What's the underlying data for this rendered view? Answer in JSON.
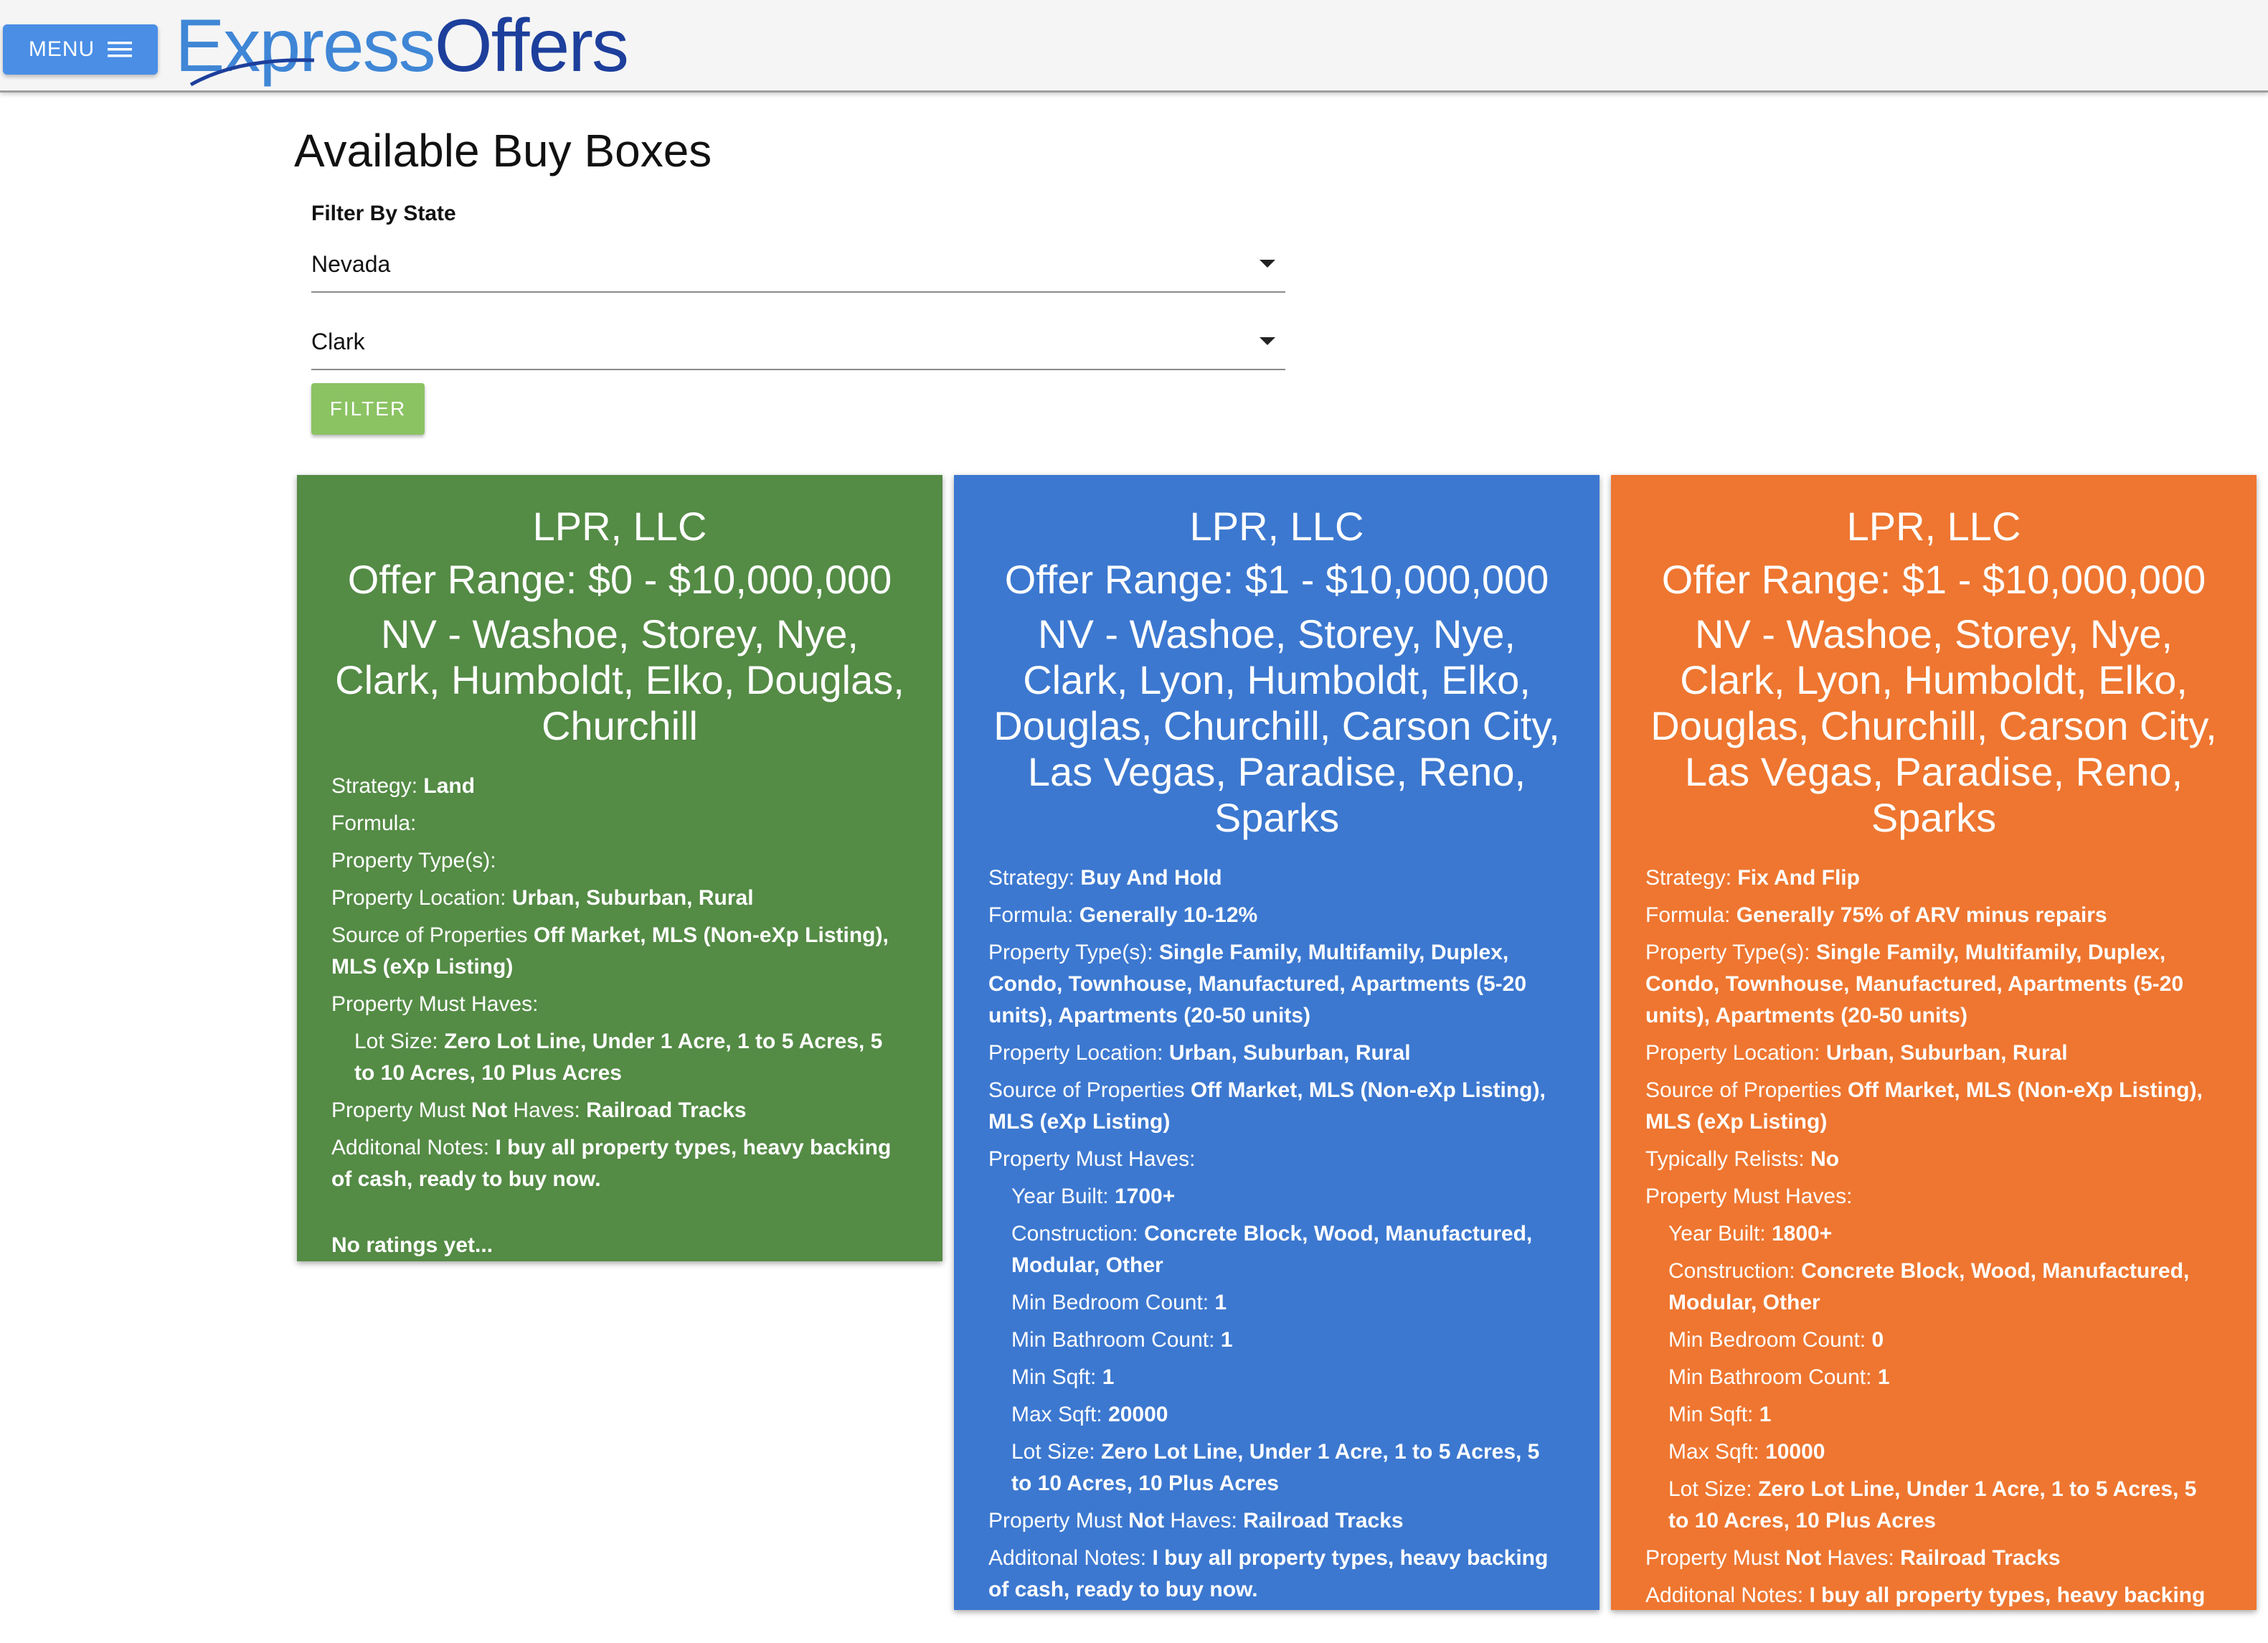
{
  "header": {
    "menu_label": "MENU",
    "logo_part1": "Express",
    "logo_part2": "Offers"
  },
  "page": {
    "title": "Available Buy Boxes",
    "filter_label": "Filter By State",
    "state_value": "Nevada",
    "county_value": "Clark",
    "filter_button": "FILTER"
  },
  "labels": {
    "strategy": "Strategy:",
    "formula": "Formula:",
    "property_types": "Property Type(s):",
    "property_location": "Property Location:",
    "source": "Source of Properties",
    "relists": "Typically Relists:",
    "must_haves": "Property Must Haves:",
    "year_built": "Year Built:",
    "construction": "Construction:",
    "min_bed": "Min Bedroom Count:",
    "min_bath": "Min Bathroom Count:",
    "min_sqft": "Min Sqft:",
    "max_sqft": "Max Sqft:",
    "lot_size": "Lot Size:",
    "not_haves_pre": "Property Must",
    "not_haves_not": "Not",
    "not_haves_post": "Haves:",
    "notes": "Additonal Notes:"
  },
  "cards": [
    {
      "color": "#548b45",
      "name": "LPR, LLC",
      "offer_range": "Offer Range: $0 - $10,000,000",
      "area": "NV - Washoe, Storey, Nye, Clark, Humboldt, Elko, Douglas, Churchill",
      "strategy": "Land",
      "formula": "",
      "property_types": "",
      "property_location": "Urban, Suburban, Rural",
      "source": "Off Market, MLS (Non-eXp Listing), MLS (eXp Listing)",
      "lot_size": "Zero Lot Line, Under 1 Acre, 1 to 5 Acres, 5 to 10 Acres, 10 Plus Acres",
      "not_haves": "Railroad Tracks",
      "notes": "I buy all property types, heavy backing of cash, ready to buy now.",
      "rating": "No ratings yet..."
    },
    {
      "color": "#3c78d0",
      "name": "LPR, LLC",
      "offer_range": "Offer Range: $1 - $10,000,000",
      "area": "NV - Washoe, Storey, Nye, Clark, Lyon, Humboldt, Elko, Douglas, Churchill, Carson City, Las Vegas, Paradise, Reno, Sparks",
      "strategy": "Buy And Hold",
      "formula": "Generally 10-12%",
      "property_types": "Single Family, Multifamily, Duplex, Condo, Townhouse, Manufactured, Apartments (5-20 units), Apartments (20-50 units)",
      "property_location": "Urban, Suburban, Rural",
      "source": "Off Market, MLS (Non-eXp Listing), MLS (eXp Listing)",
      "year_built": "1700+",
      "construction": "Concrete Block, Wood, Manufactured, Modular, Other",
      "min_bed": "1",
      "min_bath": "1",
      "min_sqft": "1",
      "max_sqft": "20000",
      "lot_size": "Zero Lot Line, Under 1 Acre, 1 to 5 Acres, 5 to 10 Acres, 10 Plus Acres",
      "not_haves": "Railroad Tracks",
      "notes": "I buy all property types, heavy backing of cash, ready to buy now."
    },
    {
      "color": "#ee7630",
      "name": "LPR, LLC",
      "offer_range": "Offer Range: $1 - $10,000,000",
      "area": "NV - Washoe, Storey, Nye, Clark, Lyon, Humboldt, Elko, Douglas, Churchill, Carson City, Las Vegas, Paradise, Reno, Sparks",
      "strategy": "Fix And Flip",
      "formula": "Generally 75% of ARV minus repairs",
      "property_types": "Single Family, Multifamily, Duplex, Condo, Townhouse, Manufactured, Apartments (5-20 units), Apartments (20-50 units)",
      "property_location": "Urban, Suburban, Rural",
      "source": "Off Market, MLS (Non-eXp Listing), MLS (eXp Listing)",
      "relists": "No",
      "year_built": "1800+",
      "construction": "Concrete Block, Wood, Manufactured, Modular, Other",
      "min_bed": "0",
      "min_bath": "1",
      "min_sqft": "1",
      "max_sqft": "10000",
      "lot_size": "Zero Lot Line, Under 1 Acre, 1 to 5 Acres, 5 to 10 Acres, 10 Plus Acres",
      "not_haves": "Railroad Tracks",
      "notes": "I buy all property types, heavy backing of cash, ready to buy now."
    }
  ]
}
